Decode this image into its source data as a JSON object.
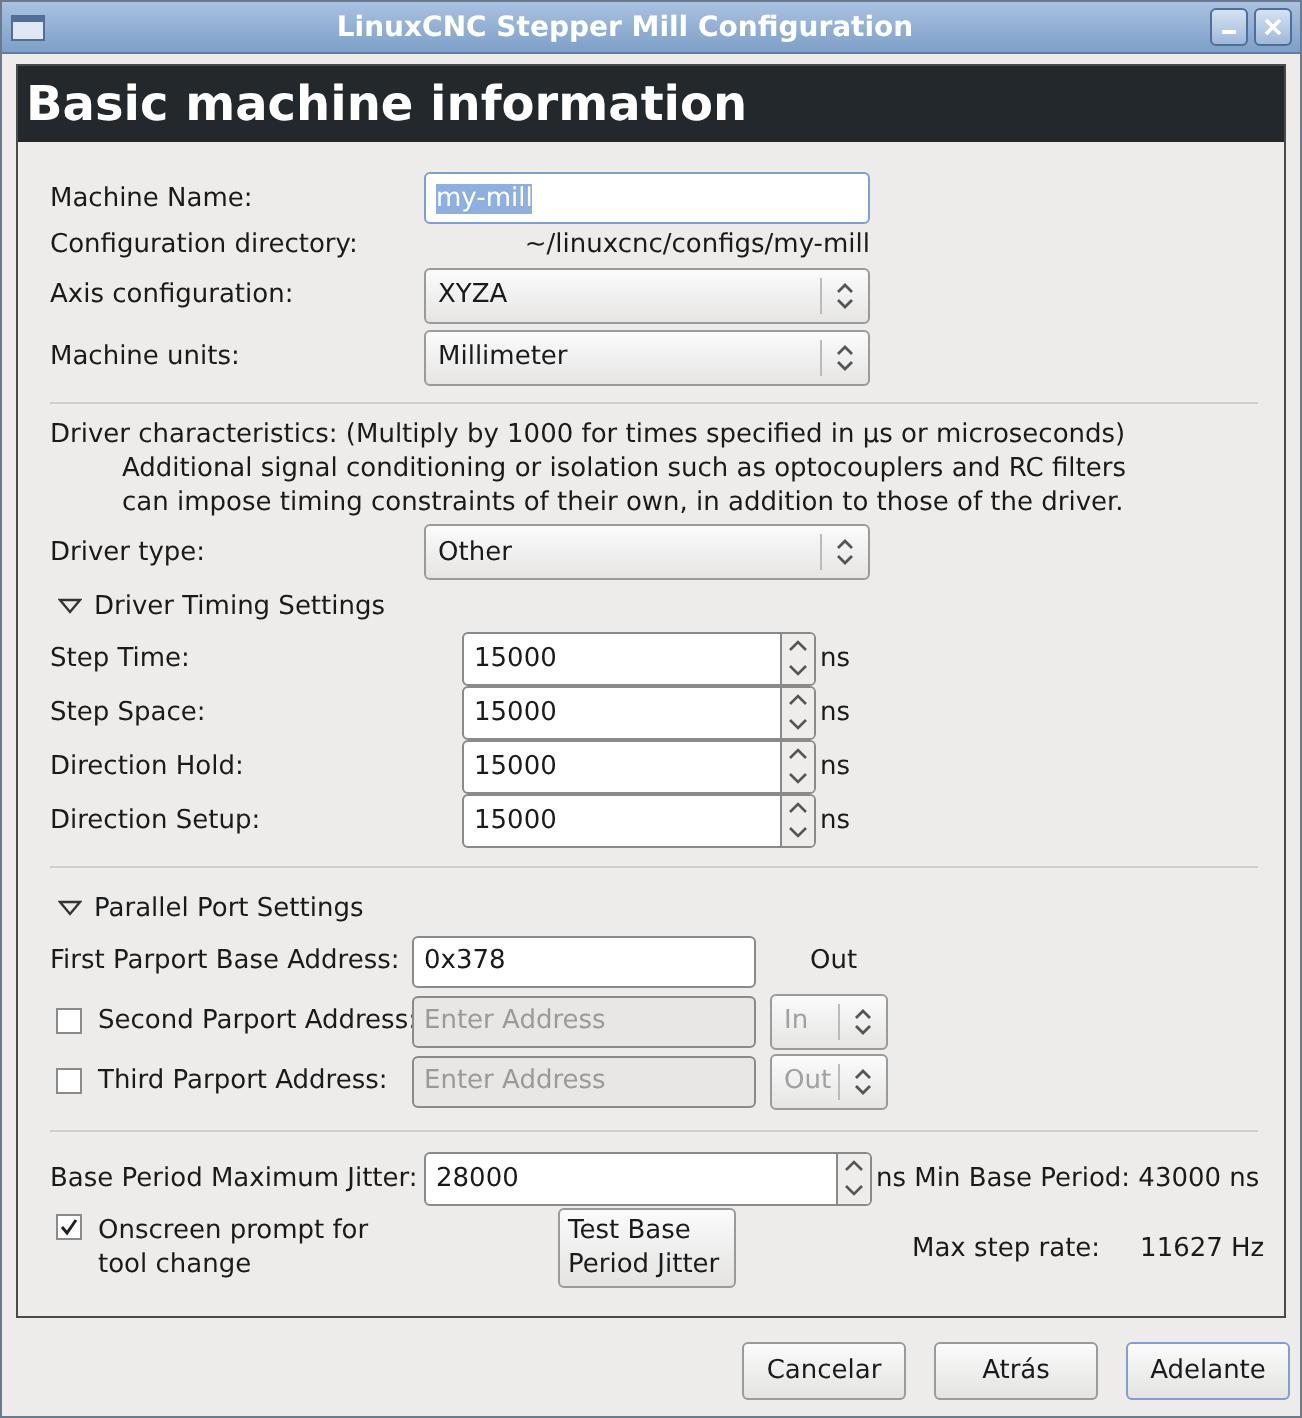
{
  "window": {
    "title": "LinuxCNC Stepper Mill Configuration"
  },
  "header": "Basic machine information",
  "basic_rows": [
    {
      "kind": "entry",
      "label": "Machine Name:",
      "value": "my-mill",
      "text_selected": true
    },
    {
      "kind": "text",
      "label": "Configuration directory:",
      "value": "~/linuxcnc/configs/my-mill"
    },
    {
      "kind": "select",
      "label": "Axis configuration:",
      "value": "XYZA"
    },
    {
      "kind": "select",
      "label": "Machine units:",
      "value": "Millimeter"
    }
  ],
  "driver": {
    "note_lines": [
      "Driver characteristics: (Multiply by 1000 for times specified in µs or microseconds)",
      "Additional signal conditioning or isolation such as optocouplers and RC filters",
      "can impose timing constraints of their own, in addition to those of the driver."
    ],
    "type_label": "Driver type:",
    "type_value": "Other",
    "timing": {
      "label": "Driver Timing Settings",
      "expanded": true,
      "rows": [
        {
          "label": "Step Time:",
          "value": "15000",
          "unit": "ns"
        },
        {
          "label": "Step Space:",
          "value": "15000",
          "unit": "ns"
        },
        {
          "label": "Direction Hold:",
          "value": "15000",
          "unit": "ns"
        },
        {
          "label": "Direction Setup:",
          "value": "15000",
          "unit": "ns"
        }
      ]
    }
  },
  "parport": {
    "label": "Parallel Port Settings",
    "expanded": true,
    "ports": [
      {
        "kind": "fixed",
        "label": "First Parport Base Address:",
        "value": "0x378",
        "direction": "Out"
      },
      {
        "kind": "optional",
        "checked": false,
        "disabled": true,
        "label": "Second Parport Address:",
        "placeholder": "Enter Address",
        "direction": "In"
      },
      {
        "kind": "optional",
        "checked": false,
        "disabled": true,
        "label": "Third Parport Address:",
        "placeholder": "Enter Address",
        "direction": "Out"
      }
    ]
  },
  "jitter": {
    "label": "Base Period Maximum Jitter:",
    "value": "28000",
    "min_period": "ns Min Base Period: 43000 ns"
  },
  "tool_prompt": {
    "checked": true,
    "label": "Onscreen prompt for tool change"
  },
  "test_button": "Test Base Period Jitter",
  "max_step": {
    "label": "Max step rate:",
    "value": "11627 Hz"
  },
  "buttons": [
    {
      "label": "Cancelar",
      "focused": false
    },
    {
      "label": "Atrás",
      "focused": false
    },
    {
      "label": "Adelante",
      "focused": true
    }
  ]
}
